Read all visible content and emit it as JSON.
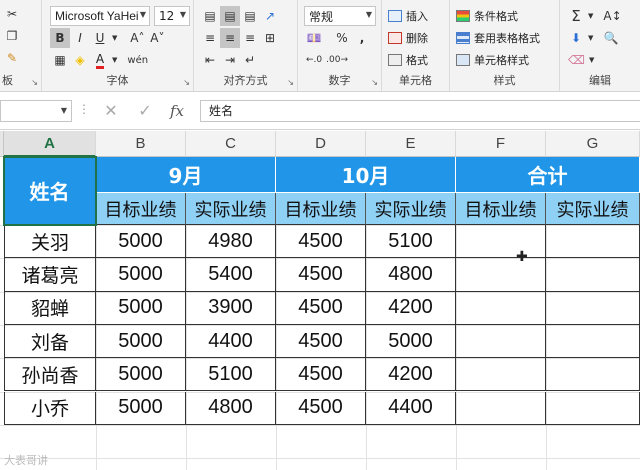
{
  "ribbon": {
    "clipboard": {
      "label": "板"
    },
    "font": {
      "label": "字体",
      "font_name": "Microsoft YaHei",
      "font_size": "12",
      "grow_label": "A˄",
      "shrink_label": "A˅",
      "bold": "B",
      "italic": "I",
      "underline": "U",
      "font_color_label": "A",
      "phonetic_label": "wén"
    },
    "alignment": {
      "label": "对齐方式"
    },
    "number": {
      "label": "数字",
      "format": "常规",
      "percent": "%",
      "comma": ","
    },
    "cells": {
      "label": "单元格",
      "insert": "插入",
      "delete": "删除",
      "format": "格式"
    },
    "styles": {
      "label": "样式",
      "conditional": "条件格式",
      "table": "套用表格格式",
      "cell_styles": "单元格样式"
    },
    "editing": {
      "label": "编辑",
      "sum": "Σ"
    }
  },
  "formula_bar": {
    "name_box": "",
    "fx": "fx",
    "content": "姓名"
  },
  "columns": [
    "A",
    "B",
    "C",
    "D",
    "E",
    "F",
    "G"
  ],
  "active_column": "A",
  "table": {
    "name_header": "姓名",
    "groups": [
      "9月",
      "10月",
      "合计"
    ],
    "subheaders": [
      "目标业绩",
      "实际业绩",
      "目标业绩",
      "实际业绩",
      "目标业绩",
      "实际业绩"
    ],
    "rows": [
      {
        "name": "关羽",
        "v": [
          "5000",
          "4980",
          "4500",
          "5100",
          "",
          ""
        ]
      },
      {
        "name": "诸葛亮",
        "v": [
          "5000",
          "5400",
          "4500",
          "4800",
          "",
          ""
        ]
      },
      {
        "name": "貂蝉",
        "v": [
          "5000",
          "3900",
          "4500",
          "4200",
          "",
          ""
        ]
      },
      {
        "name": "刘备",
        "v": [
          "5000",
          "4400",
          "4500",
          "5000",
          "",
          ""
        ]
      },
      {
        "name": "孙尚香",
        "v": [
          "5000",
          "5100",
          "4500",
          "4200",
          "",
          ""
        ]
      },
      {
        "name": "小乔",
        "v": [
          "5000",
          "4800",
          "4500",
          "4400",
          "",
          ""
        ]
      }
    ]
  },
  "colors": {
    "header_blue": "#2196e8",
    "subheader_blue": "#8fd0f5",
    "excel_green": "#217346",
    "font_red": "#e02020"
  },
  "watermark": "大表哥讲"
}
